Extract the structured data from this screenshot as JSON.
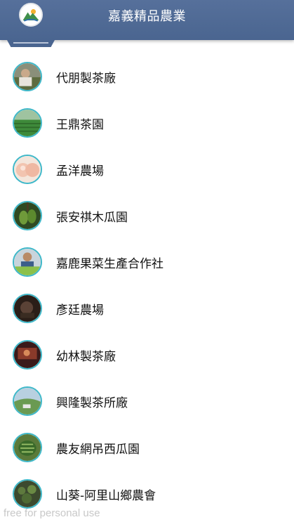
{
  "app_bar": {
    "title": "嘉義精品農業",
    "logo_icon": "mountain-sun-logo-icon",
    "background": "#4e6a96"
  },
  "list": {
    "items": [
      {
        "label": "代朋製茶廠",
        "avatar_icon": "tea-factory-photo-icon"
      },
      {
        "label": "王鼎茶園",
        "avatar_icon": "tea-garden-photo-icon"
      },
      {
        "label": "孟洋農場",
        "avatar_icon": "peach-photo-icon"
      },
      {
        "label": "張安祺木瓜園",
        "avatar_icon": "papaya-photo-icon"
      },
      {
        "label": "嘉鹿果菜生產合作社",
        "avatar_icon": "farmer-photo-icon"
      },
      {
        "label": "彥廷農場",
        "avatar_icon": "farm-dark-photo-icon"
      },
      {
        "label": "幼林製茶廠",
        "avatar_icon": "tea-factory-interior-photo-icon"
      },
      {
        "label": "興隆製茶所廠",
        "avatar_icon": "tea-hill-photo-icon"
      },
      {
        "label": "農友網吊西瓜園",
        "avatar_icon": "watermelon-photo-icon"
      },
      {
        "label": "山葵-阿里山鄉農會",
        "avatar_icon": "wasabi-field-photo-icon"
      }
    ]
  },
  "watermark": "free for personal use",
  "accent_color": "#3fb8c9"
}
